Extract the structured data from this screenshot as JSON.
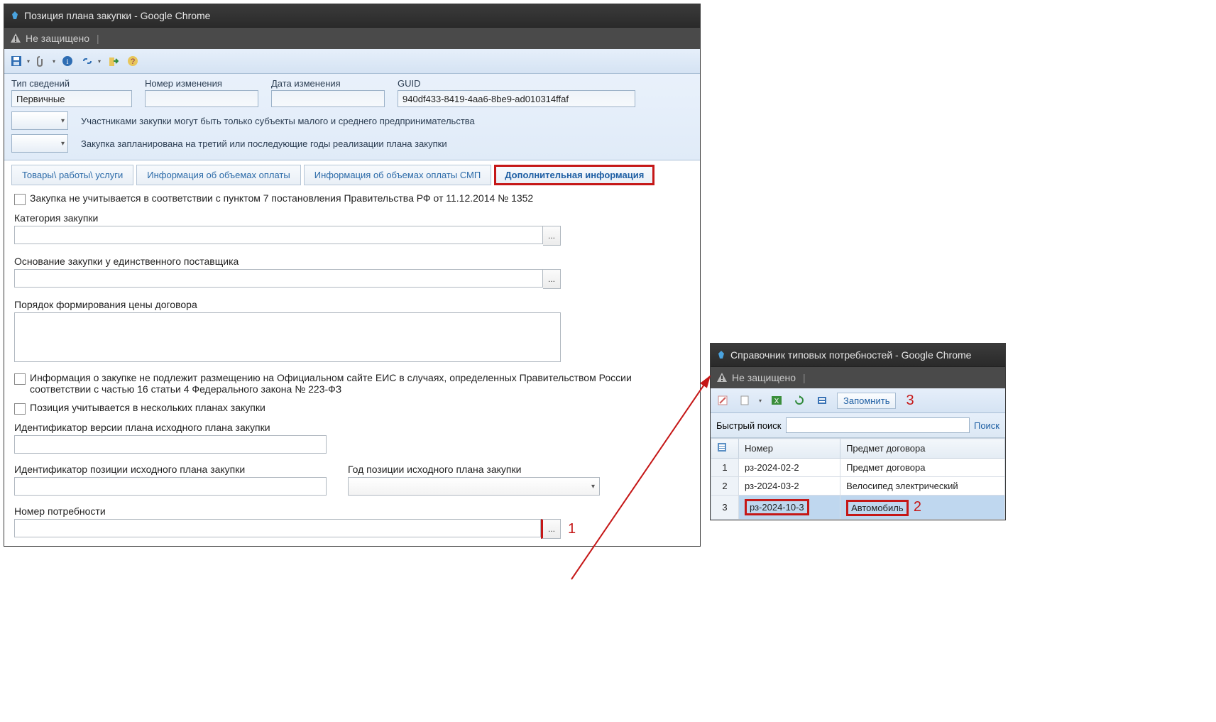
{
  "win1": {
    "title": "Позиция плана закупки - Google Chrome",
    "notsecure": "Не защищено",
    "form": {
      "type_label": "Тип сведений",
      "type_value": "Первичные",
      "chg_num_label": "Номер изменения",
      "chg_num_value": "",
      "chg_date_label": "Дата изменения",
      "chg_date_value": "",
      "guid_label": "GUID",
      "guid_value": "940df433-8419-4aa6-8be9-ad010314ffaf",
      "smsp_text": "Участниками закупки могут быть только субъекты малого и среднего предпринимательства",
      "plan3_text": "Закупка запланирована на третий или последующие годы реализации плана закупки"
    },
    "tabs": {
      "t1": "Товары\\ работы\\ услуги",
      "t2": "Информация об объемах оплаты",
      "t3": "Информация об объемах оплаты СМП",
      "t4": "Дополнительная информация"
    },
    "content": {
      "chk1": "Закупка не учитывается в соответствии с пунктом 7 постановления Правительства РФ от 11.12.2014 № 1352",
      "cat_label": "Категория закупки",
      "basis_label": "Основание закупки у единственного поставщика",
      "price_order_label": "Порядок формирования цены договора",
      "chk_eis": "Информация о закупке не подлежит размещению на Официальном сайте ЕИС в случаях, определенных Правительством России соответствии с частью 16 статьи 4 Федерального закона № 223-ФЗ",
      "chk_multi": "Позиция учитывается в нескольких планах закупки",
      "ident_ver_label": "Идентификатор версии плана исходного плана закупки",
      "ident_pos_label": "Идентификатор позиции исходного плана закупки",
      "year_pos_label": "Год позиции исходного плана закупки",
      "need_num_label": "Номер потребности",
      "lookup_btn": "..."
    },
    "annotate1": "1"
  },
  "win2": {
    "title": "Справочник типовых потребностей - Google Chrome",
    "notsecure": "Не защищено",
    "remember": "Запомнить",
    "quick_search_label": "Быстрый поиск",
    "search_btn": "Поиск",
    "cols": {
      "num": "Номер",
      "subj": "Предмет договора"
    },
    "rows": [
      {
        "idx": "1",
        "num": "рз-2024-02-2",
        "subj": "Предмет договора"
      },
      {
        "idx": "2",
        "num": "рз-2024-03-2",
        "subj": "Велосипед электрический"
      },
      {
        "idx": "3",
        "num": "рз-2024-10-3",
        "subj": "Автомобиль"
      }
    ],
    "annotate2": "2",
    "annotate3": "3"
  }
}
